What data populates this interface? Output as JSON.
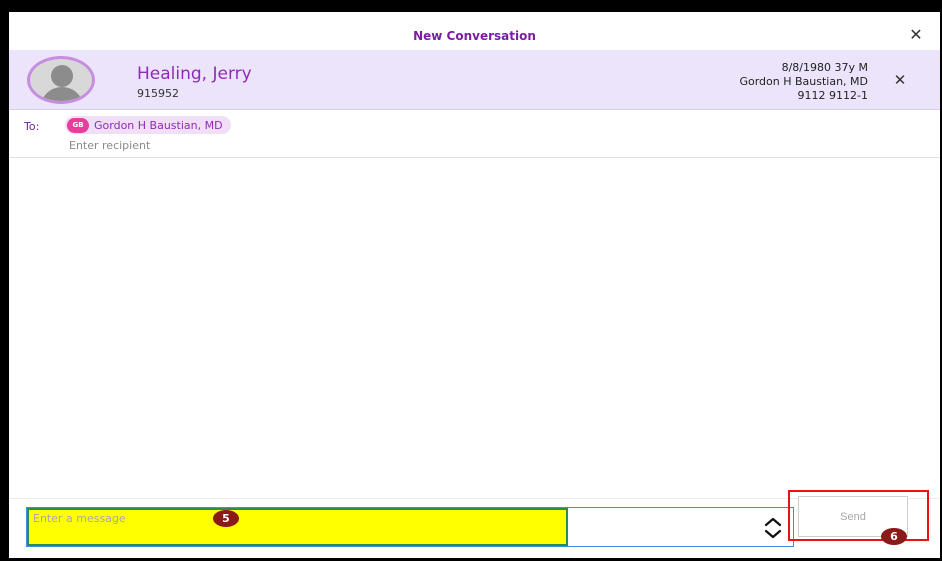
{
  "window": {
    "title": "New Conversation"
  },
  "patient": {
    "name": "Healing, Jerry",
    "id": "915952",
    "dob_age_sex": "8/8/1980 37y M",
    "provider": "Gordon H Baustian, MD",
    "account": "9112 9112-1"
  },
  "recipients": {
    "to_label": "To:",
    "chips": [
      {
        "initials": "GB",
        "name": "Gordon H Baustian, MD"
      }
    ],
    "input_placeholder": "Enter recipient"
  },
  "composer": {
    "message_placeholder": "Enter a message",
    "send_label": "Send"
  },
  "annotations": {
    "message_badge": "5",
    "send_badge": "6"
  },
  "colors": {
    "accent": "#8f2cb7",
    "patient_bar_bg": "#ece4fb",
    "highlight_fill": "#ffff00",
    "badge_bg": "#8b1a1a",
    "highlight_border": "#e11111"
  },
  "icons": {
    "title_close": "close-icon",
    "patient_close": "close-icon",
    "expand": "expand-collapse-icon"
  }
}
